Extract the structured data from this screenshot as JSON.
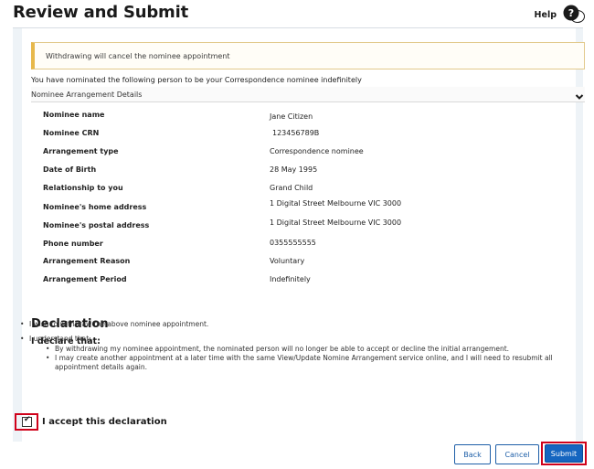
{
  "header": {
    "title": "Review and Submit",
    "help_label": "Help"
  },
  "alert": {
    "text": "Withdrawing will cancel the nominee appointment"
  },
  "intro": {
    "text": "You have nominated the following person to be your Correspondence nominee indefinitely"
  },
  "section": {
    "label": "Nominee Arrangement Details"
  },
  "details": [
    {
      "label": "Nominee name",
      "value": "Jane Citizen"
    },
    {
      "label": "Nominee CRN",
      "value": "123456789B"
    },
    {
      "label": "Arrangement type",
      "value": "Correspondence nominee"
    },
    {
      "label": "Date of Birth",
      "value": "28 May 1995"
    },
    {
      "label": "Relationship to you",
      "value": "Grand Child"
    },
    {
      "label": "Nominee's home address",
      "value": "1 Digital Street Melbourne VIC 3000"
    },
    {
      "label": "Nominee's postal address",
      "value": "1 Digital Street Melbourne VIC 3000"
    },
    {
      "label": "Phone number",
      "value": "0355555555"
    },
    {
      "label": "Arrangement Reason",
      "value": "Voluntary"
    },
    {
      "label": "Arrangement Period",
      "value": "Indefinitely"
    }
  ],
  "declaration": {
    "title": "Declaration",
    "subtitle": "I declare that:",
    "item1": "I wish to withdraw the above nominee appointment.",
    "item2": "I understand that:",
    "sub1": "By withdrawing my nominee appointment, the nominated person will no longer be able to accept or decline the initial arrangement.",
    "sub2": "I may create another appointment at a later time with the same View/Update Nomine Arrangement service online, and I will need to resubmit all appointment details again.",
    "accept_label": "I accept this declaration",
    "accepted": true
  },
  "actions": {
    "back": "Back",
    "cancel": "Cancel",
    "submit": "Submit"
  },
  "colors": {
    "primary": "#1565c0",
    "highlight": "#d0021b",
    "alert_border": "#e7b84a"
  }
}
